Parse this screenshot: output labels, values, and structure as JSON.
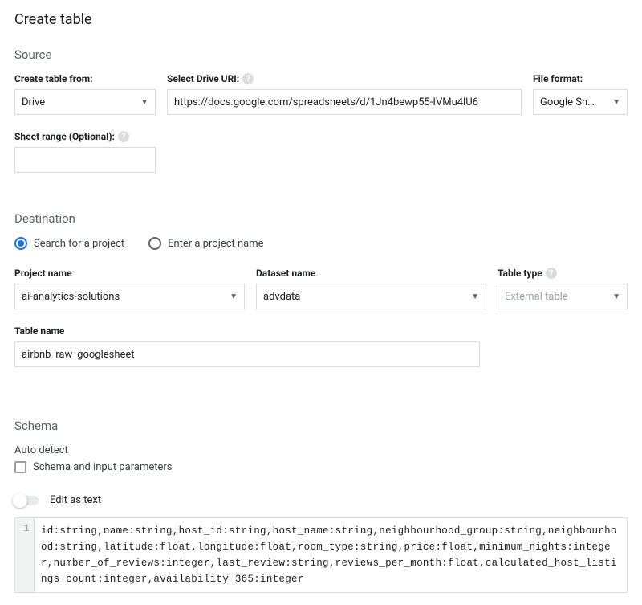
{
  "title": "Create table",
  "source": {
    "heading": "Source",
    "create_from_label": "Create table from:",
    "create_from_value": "Drive",
    "drive_uri_label": "Select Drive URI:",
    "drive_uri_value": "https://docs.google.com/spreadsheets/d/1Jn4bewp55-IVMu4lU6",
    "file_format_label": "File format:",
    "file_format_value": "Google Sh…",
    "sheet_range_label": "Sheet range (Optional):",
    "sheet_range_value": ""
  },
  "destination": {
    "heading": "Destination",
    "radio_search_label": "Search for a project",
    "radio_enter_label": "Enter a project name",
    "radio_selected": "search",
    "project_name_label": "Project name",
    "project_name_value": "ai-analytics-solutions",
    "dataset_name_label": "Dataset name",
    "dataset_name_value": "advdata",
    "table_type_label": "Table type",
    "table_type_value": "External table",
    "table_name_label": "Table name",
    "table_name_value": "airbnb_raw_googlesheet"
  },
  "schema": {
    "heading": "Schema",
    "auto_detect_label": "Auto detect",
    "auto_detect_checkbox_label": "Schema and input parameters",
    "edit_as_text_label": "Edit as text",
    "line_number": "1",
    "schema_text": "id:string,name:string,host_id:string,host_name:string,neighbourhood_group:string,neighbourhood:string,latitude:float,longitude:float,room_type:string,price:float,minimum_nights:integer,number_of_reviews:integer,last_review:string,reviews_per_month:float,calculated_host_listings_count:integer,availability_365:integer"
  }
}
